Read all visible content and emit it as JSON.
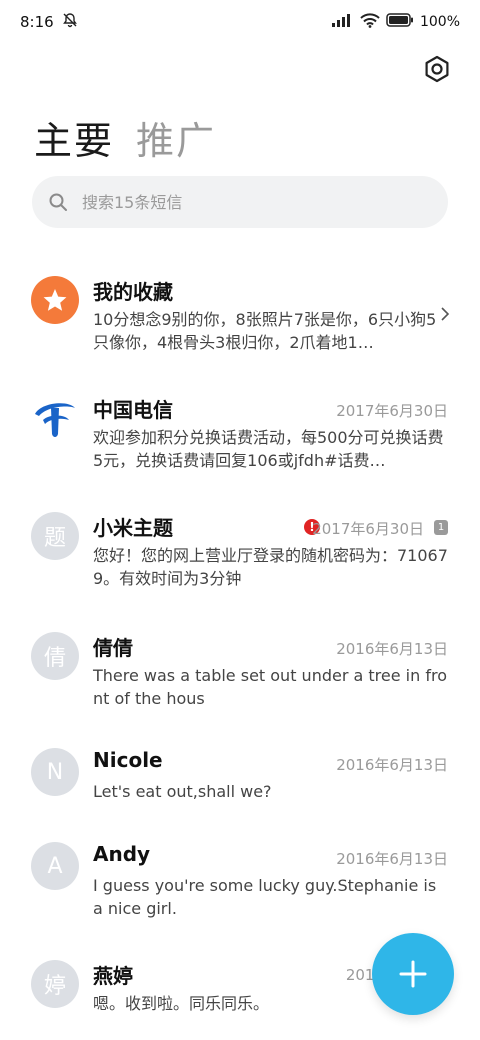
{
  "status_bar": {
    "time": "8:16",
    "battery_percent": "100%",
    "icons": [
      "mute-bell-icon",
      "signal-icon",
      "wifi-icon",
      "battery-icon"
    ]
  },
  "header": {
    "tabs": [
      {
        "label": "主要",
        "active": true
      },
      {
        "label": "推广",
        "active": false
      }
    ],
    "settings_icon": "settings-icon"
  },
  "search": {
    "placeholder": "搜索15条短信"
  },
  "conversations": [
    {
      "name": "我的收藏",
      "date": "",
      "preview": "10分想念9别的你，8张照片7张是你，6只小狗5只像你，4根骨头3根归你，2爪着地1…",
      "avatar": "star-icon",
      "avatar_color": "#f47a3a",
      "chevron": true
    },
    {
      "name": "中国电信",
      "date": "2017年6月30日",
      "preview": "欢迎参加积分兑换话费活动，每500分可兑换话费5元，兑换话费请回复106或jfdh#话费…",
      "avatar": "china-telecom-logo-icon"
    },
    {
      "name": "小米主题",
      "date": "2017年6月30日",
      "preview": "您好！您的网上营业厅登录的随机密码为：710679。有效时间为3分钟",
      "avatar_text": "题",
      "error": "!",
      "sim_badge": "1"
    },
    {
      "name": "倩倩",
      "date": "2016年6月13日",
      "preview": "There was a table set out under a tree in front of the hous",
      "avatar_text": "倩"
    },
    {
      "name": "Nicole",
      "date": "2016年6月13日",
      "preview": "Let's eat out,shall we?",
      "avatar_text": "N"
    },
    {
      "name": "Andy",
      "date": "2016年6月13日",
      "preview": "I guess you're some lucky guy.Stephanie is a nice girl.",
      "avatar_text": "A"
    },
    {
      "name": "燕婷",
      "date": "2013",
      "preview": "嗯。收到啦。同乐同乐。",
      "avatar_text": "婷"
    }
  ],
  "fab": {
    "icon": "plus-icon",
    "color": "#2fb6e8"
  }
}
